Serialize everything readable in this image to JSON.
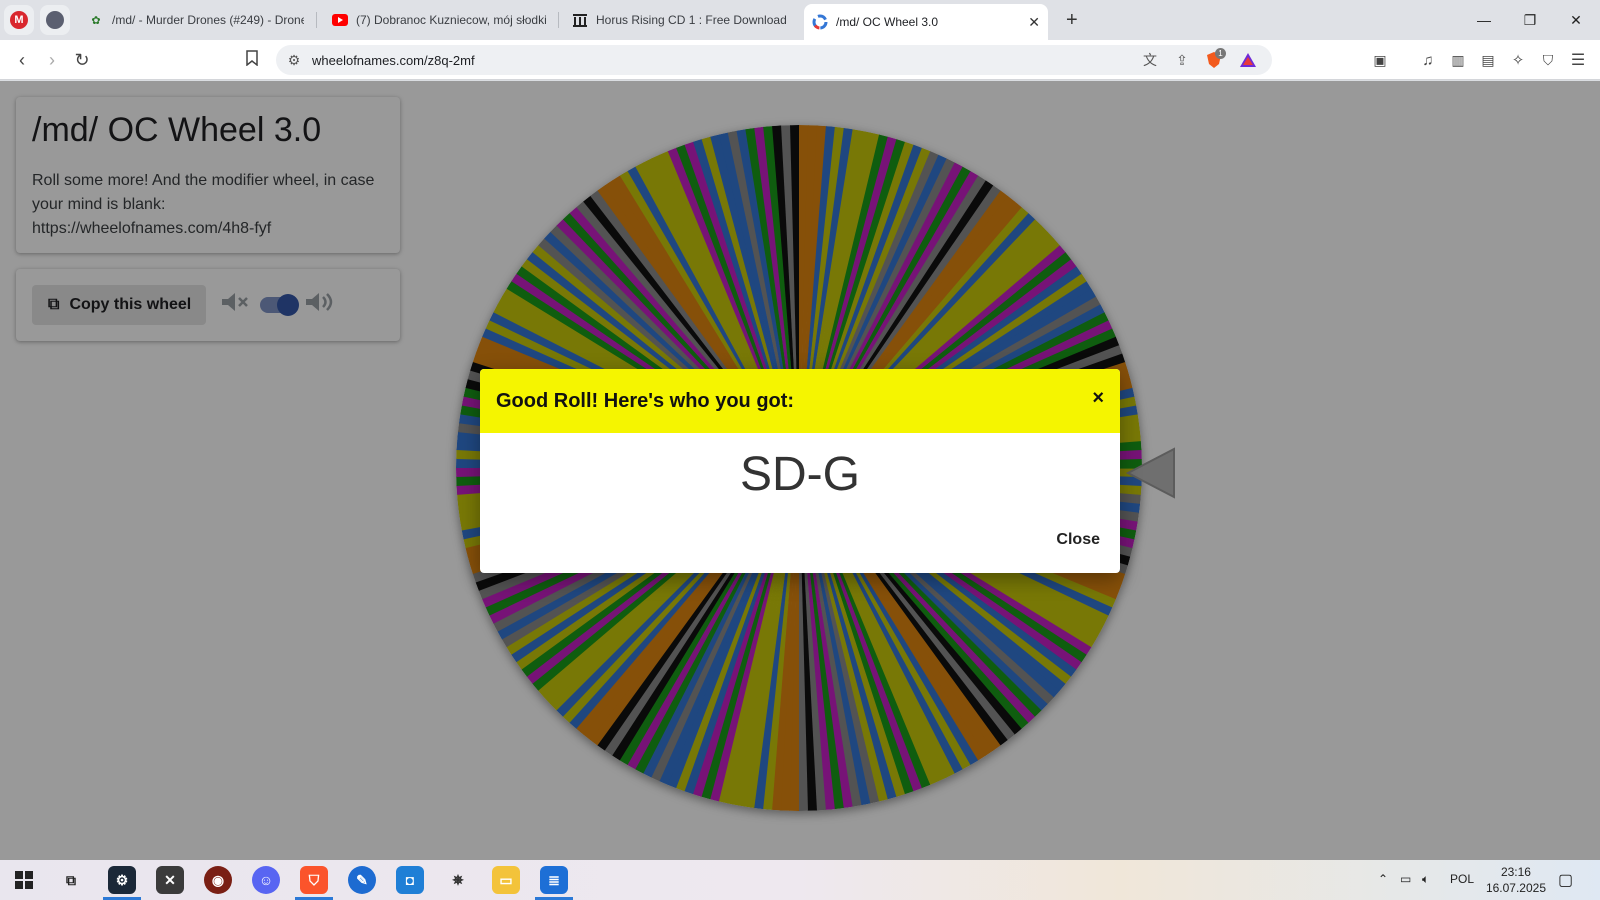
{
  "browser": {
    "tabs": [
      {
        "label": "/md/ - Murder Drones (#249) - Drones",
        "active": false
      },
      {
        "label": "(7) Dobranoc Kuzniecow, mój słodki k",
        "active": false
      },
      {
        "label": "Horus Rising CD 1 : Free Download, B",
        "active": false
      },
      {
        "label": "/md/ OC Wheel 3.0",
        "active": true
      }
    ],
    "tab_close": "✕",
    "new_tab": "+",
    "url": "wheelofnames.com/z8q-2mf",
    "shields_badge": "1"
  },
  "page": {
    "title": "/md/ OC Wheel 3.0",
    "description": "Roll some more! And the modifier wheel, in case your mind is blank: https://wheelofnames.com/4h8-fyf",
    "copy_button": "Copy this wheel"
  },
  "modal": {
    "title": "Good Roll! Here's who you got:",
    "close_x": "×",
    "winner": "SD-G",
    "close_button": "Close",
    "header_color": "#f5f500"
  },
  "wheel": {
    "colors": [
      "#c9c90a",
      "#3477d6",
      "#1a9b1a",
      "#c620c6",
      "#e0850f",
      "#8a8a8a",
      "#c9c90a",
      "#111111",
      "#3477d6",
      "#c9c90a",
      "#c620c6",
      "#1a9b1a",
      "#e0850f",
      "#3477d6",
      "#c9c90a",
      "#8a8a8a"
    ]
  },
  "taskbar": {
    "tray_lang": "POL",
    "time": "23:16",
    "date": "16.07.2025"
  }
}
